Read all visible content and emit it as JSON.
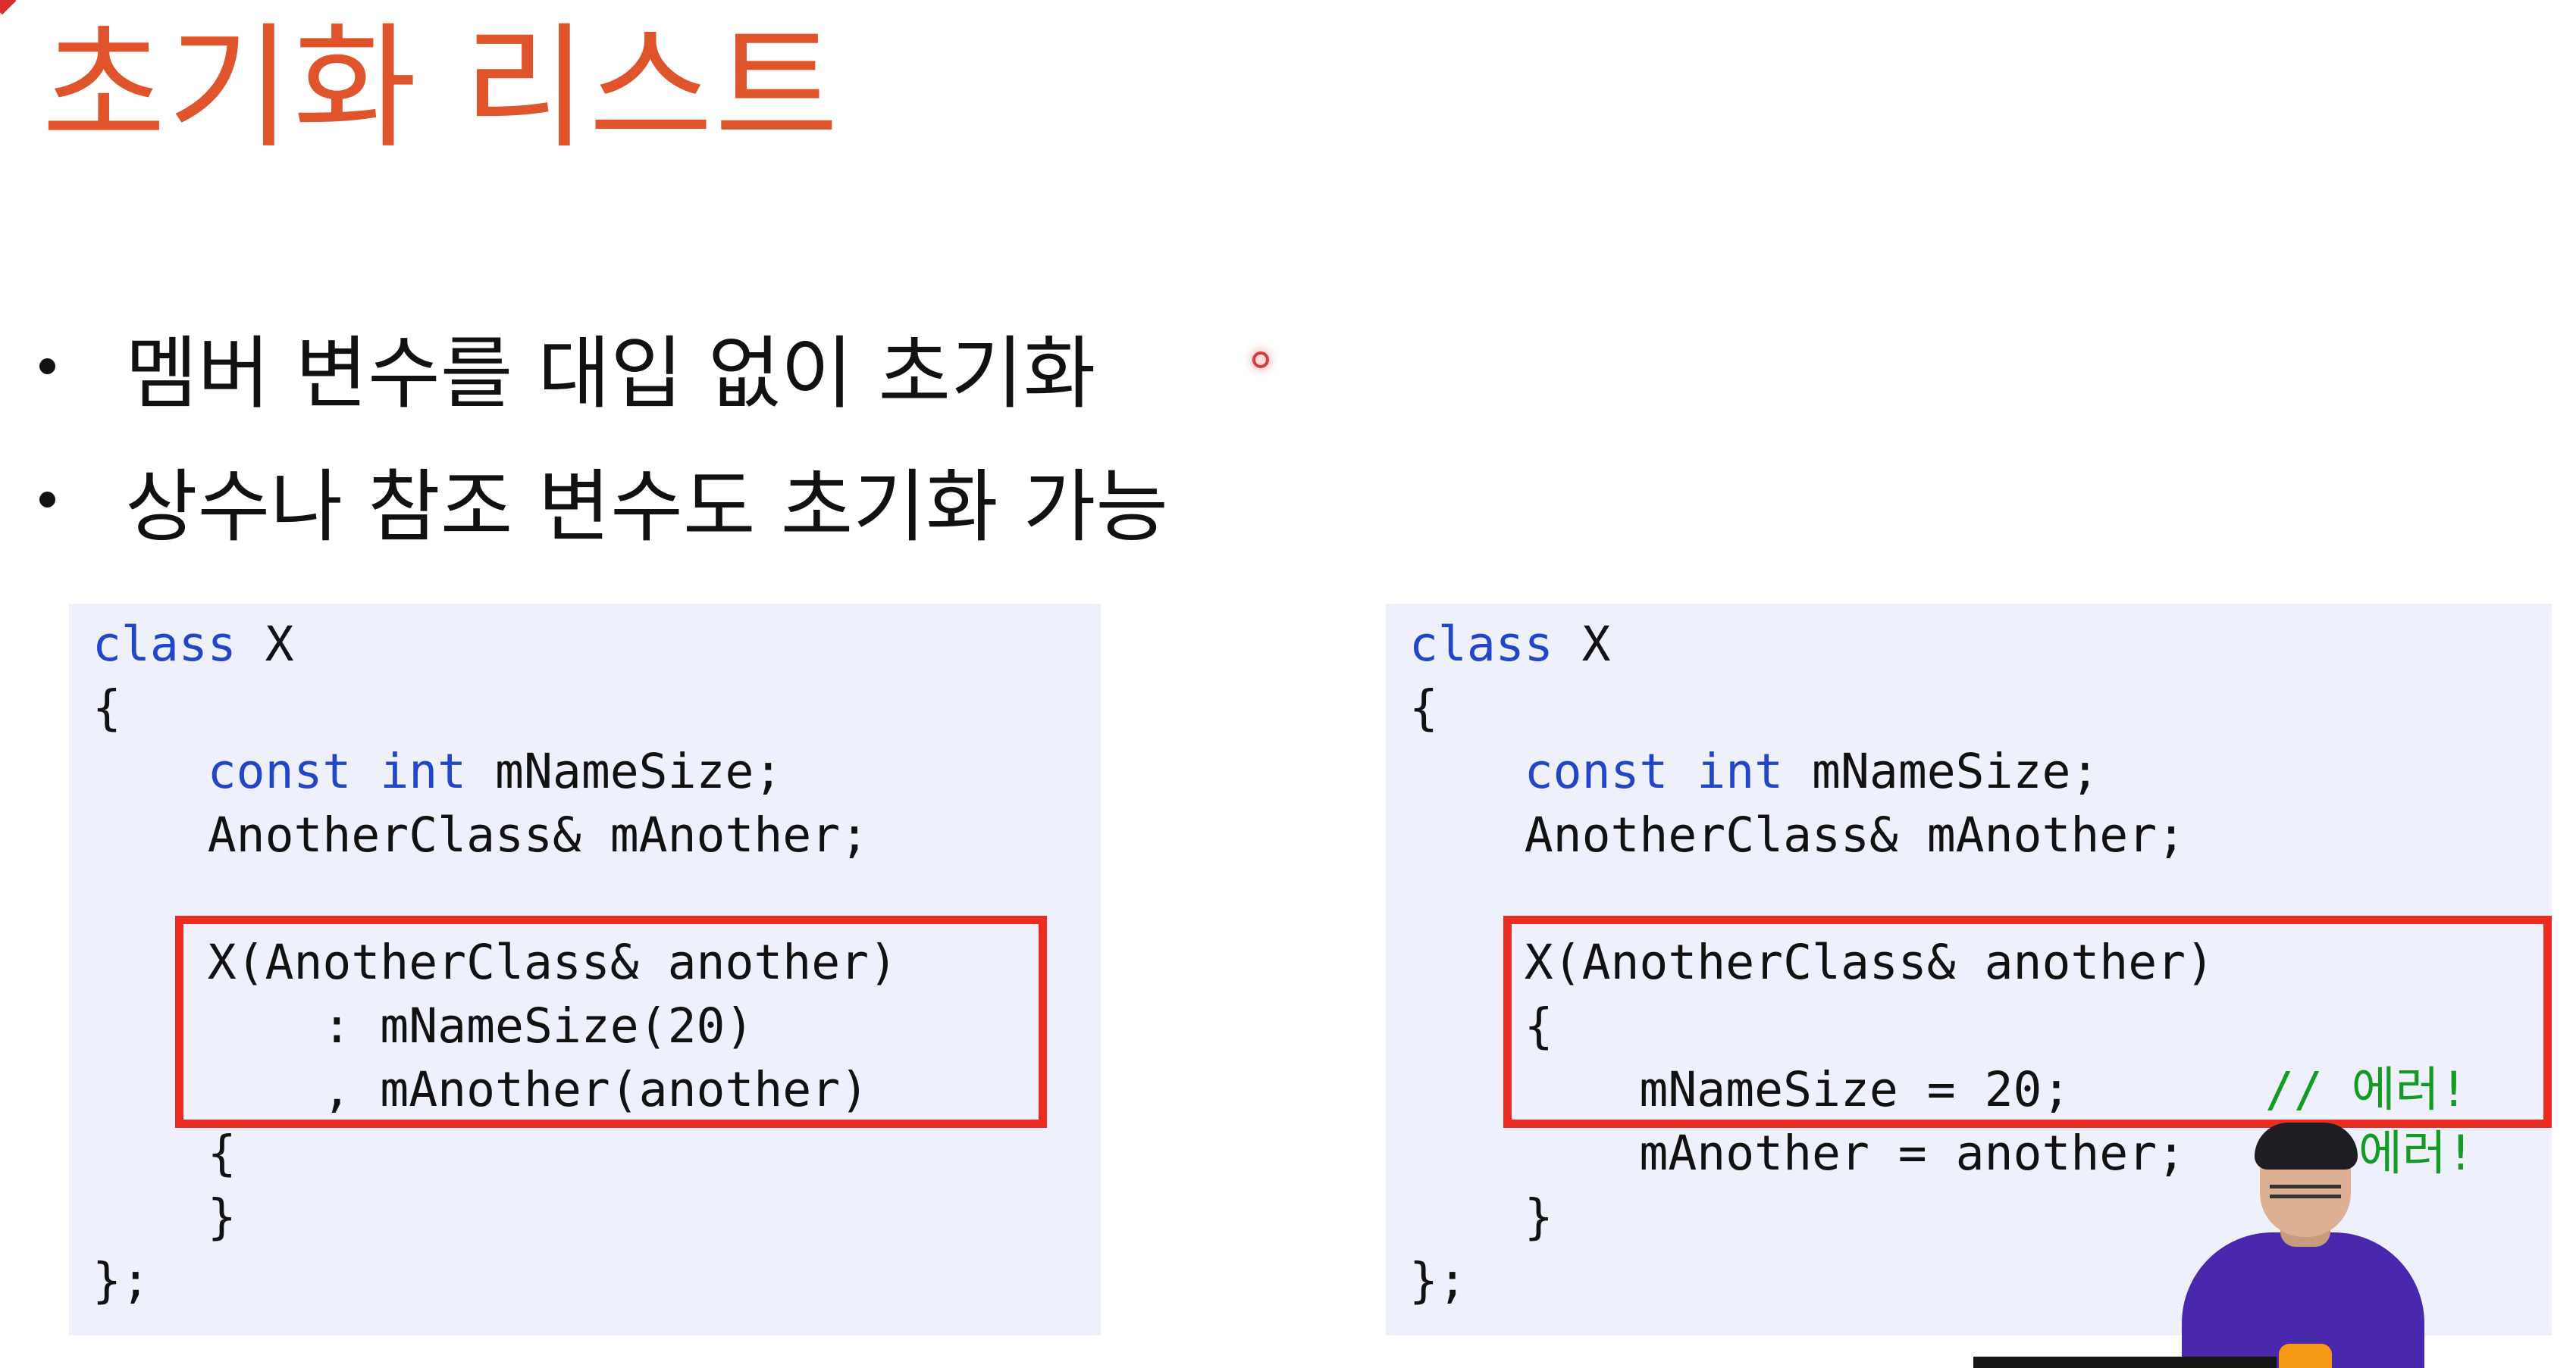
{
  "slide": {
    "title": "초기화 리스트",
    "bullets": [
      "멤버 변수를 대입 없이 초기화",
      "상수나 참조 변수도 초기화 가능"
    ]
  },
  "code_examples": {
    "left": {
      "class_keyword": "class",
      "class_name": " X",
      "lines": [
        "{",
        "    ",
        "    AnotherClass& mAnother;",
        "    X(AnotherClass& another)",
        "        : mNameSize(20)",
        "        , mAnother(another)",
        "    {",
        "    }",
        "};"
      ],
      "const_keyword": "const",
      "int_keyword": "int",
      "member_declaration": " mNameSize;"
    },
    "right": {
      "class_keyword": "class",
      "class_name": " X",
      "lines": [
        "{",
        "    ",
        "    AnotherClass& mAnother;",
        "    X(AnotherClass& another)",
        "    {",
        "        mNameSize = 20;",
        "        mAnother = another;",
        "    }",
        "};"
      ],
      "const_keyword": "const",
      "int_keyword": "int",
      "member_declaration": " mNameSize;",
      "comments": [
        "// 에러!",
        "에러!"
      ]
    }
  },
  "colors": {
    "title": "#e0542c",
    "keyword": "#2246c8",
    "comment": "#139b24",
    "highlight_border": "#ea2c22",
    "code_background": "#eef0fb"
  }
}
